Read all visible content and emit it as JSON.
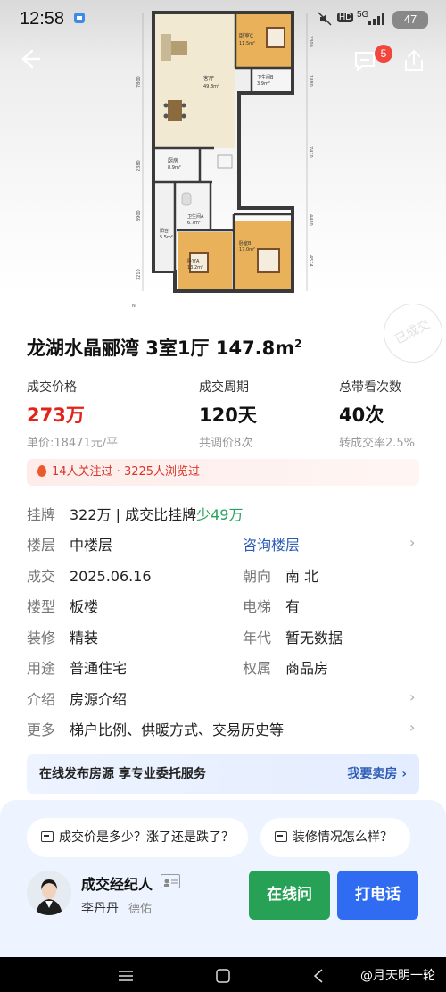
{
  "status_bar": {
    "time": "12:58",
    "network": "5G",
    "battery": "47",
    "hd": "HD"
  },
  "header": {
    "notification_count": "5"
  },
  "floorplan": {
    "rooms": {
      "living": {
        "name": "客厅",
        "area": "49.8m²"
      },
      "bedroom_c": {
        "name": "卧室C",
        "area": "11.5m²"
      },
      "bath_b": {
        "name": "卫生间B",
        "area": "3.9m²"
      },
      "kitchen": {
        "name": "厨房",
        "area": "8.9m²"
      },
      "bath_a": {
        "name": "卫生间A",
        "area": "6.7m²"
      },
      "balcony": {
        "name": "阳台",
        "area": "5.5m²"
      },
      "bedroom_a": {
        "name": "卧室A",
        "area": "13.2m²"
      },
      "bedroom_b": {
        "name": "卧室B",
        "area": "17.0m²"
      }
    },
    "dims": {
      "left_1": "7800",
      "left_2": "2380",
      "left_3": "3900",
      "left_4": "3210",
      "right_1": "3300",
      "right_2": "1880",
      "right_3": "7470",
      "right_4": "4480",
      "right_5": "4574"
    },
    "stamp_text": "已成交"
  },
  "listing": {
    "title": "龙湖水晶郦湾 3室1厅 147.8m",
    "title_sup": "2"
  },
  "stats": [
    {
      "label": "成交价格",
      "value": "273万",
      "sub": "单价:18471元/平"
    },
    {
      "label": "成交周期",
      "value": "120天",
      "sub": "共调价8次"
    },
    {
      "label": "总带看次数",
      "value": "40次",
      "sub": "转成交率2.5%"
    }
  ],
  "attention": {
    "text": "14人关注过 · 3225人浏览过"
  },
  "details": {
    "listing_key": "挂牌",
    "listing_value": "322万 | 成交比挂牌",
    "listing_diff": "少49万",
    "floor_key": "楼层",
    "floor_value": "中楼层",
    "floor_link": "咨询楼层",
    "deal_key": "成交",
    "deal_value": "2025.06.16",
    "orient_key": "朝向",
    "orient_value": "南 北",
    "type_key": "楼型",
    "type_value": "板楼",
    "elevator_key": "电梯",
    "elevator_value": "有",
    "deco_key": "装修",
    "deco_value": "精装",
    "year_key": "年代",
    "year_value": "暂无数据",
    "use_key": "用途",
    "use_value": "普通住宅",
    "own_key": "权属",
    "own_value": "商品房",
    "intro_key": "介绍",
    "intro_value": "房源介绍",
    "more_key": "更多",
    "more_value": "梯户比例、供暖方式、交易历史等"
  },
  "banner": {
    "text": "在线发布房源 享专业委托服务",
    "cta": "我要卖房"
  },
  "questions": [
    "成交价是多少？涨了还是跌了？",
    "装修情况怎么样？"
  ],
  "agent": {
    "title": "成交经纪人",
    "name": "李丹丹",
    "company": "德佑"
  },
  "actions": {
    "chat": "在线问",
    "call": "打电话"
  },
  "watermark": "@月天明一轮"
}
